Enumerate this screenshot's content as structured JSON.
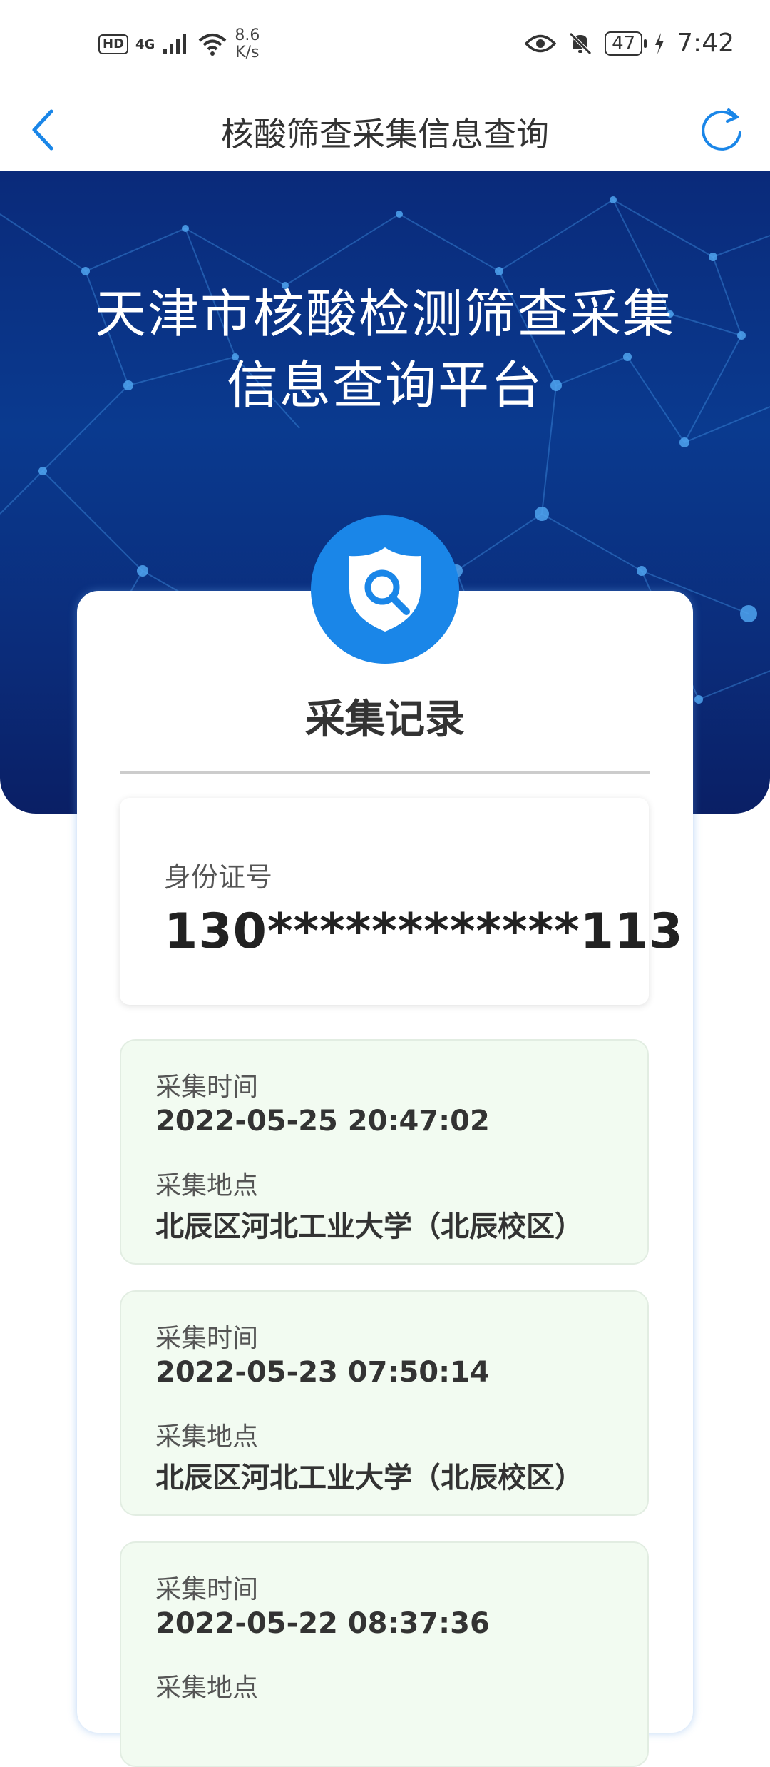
{
  "status_bar": {
    "hd": "HD",
    "network": "4G",
    "speed_value": "8.6",
    "speed_unit": "K/s",
    "battery": "47",
    "time": "7:42"
  },
  "nav": {
    "title": "核酸筛查采集信息查询"
  },
  "hero": {
    "title_line1": "天津市核酸检测筛查采集",
    "title_line2": "信息查询平台"
  },
  "card": {
    "title": "采集记录",
    "id_label": "身份证号",
    "id_value": "130************113"
  },
  "records": [
    {
      "time_label": "采集时间",
      "time": "2022-05-25 20:47:02",
      "place_label": "采集地点",
      "place": "北辰区河北工业大学（北辰校区）"
    },
    {
      "time_label": "采集时间",
      "time": "2022-05-23 07:50:14",
      "place_label": "采集地点",
      "place": "北辰区河北工业大学（北辰校区）"
    },
    {
      "time_label": "采集时间",
      "time": "2022-05-22 08:37:36",
      "place_label": "采集地点",
      "place": ""
    }
  ],
  "colors": {
    "accent": "#1a86e8",
    "hero_bg": "#0a2a7a",
    "record_bg": "#f2fbf1"
  },
  "icons": {
    "back": "chevron-left-icon",
    "refresh": "refresh-icon",
    "shield": "shield-search-icon"
  }
}
